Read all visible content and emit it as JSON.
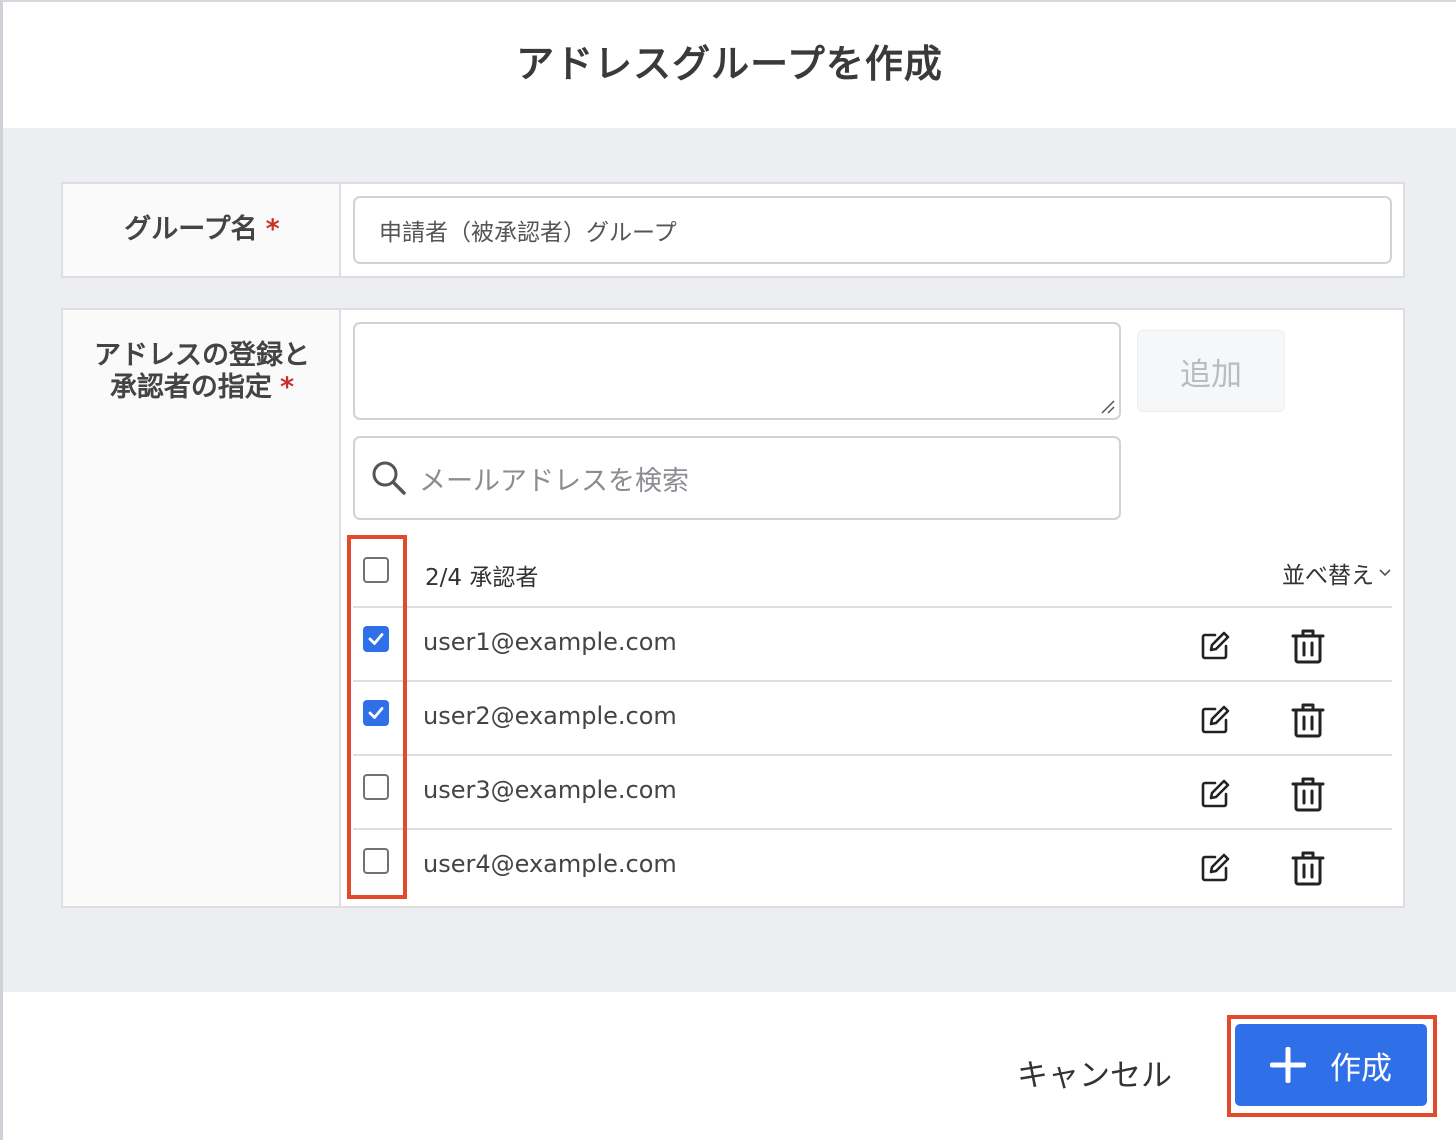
{
  "dialog": {
    "title": "アドレスグループを作成"
  },
  "group_name": {
    "label": "グループ名",
    "required_mark": "*",
    "value": "申請者（被承認者）グループ"
  },
  "address": {
    "label_line1": "アドレスの登録と",
    "label_line2": "承認者の指定",
    "required_mark": "*",
    "textarea_value": "",
    "add_label": "追加",
    "search_placeholder": "メールアドレスを検索"
  },
  "list": {
    "count_text": "2/4 承認者",
    "sort_label": "並べ替え",
    "select_all_checked": false,
    "rows": [
      {
        "email": "user1@example.com",
        "checked": true
      },
      {
        "email": "user2@example.com",
        "checked": true
      },
      {
        "email": "user3@example.com",
        "checked": false
      },
      {
        "email": "user4@example.com",
        "checked": false
      }
    ]
  },
  "footer": {
    "cancel_label": "キャンセル",
    "create_label": "作成"
  },
  "colors": {
    "accent": "#2f6fe8",
    "highlight": "#e34a2a",
    "required": "#c9302c"
  },
  "icons": {
    "search": "search-icon",
    "edit": "edit-icon",
    "trash": "trash-icon",
    "plus": "plus-icon",
    "chevron": "chevron-down-icon"
  }
}
